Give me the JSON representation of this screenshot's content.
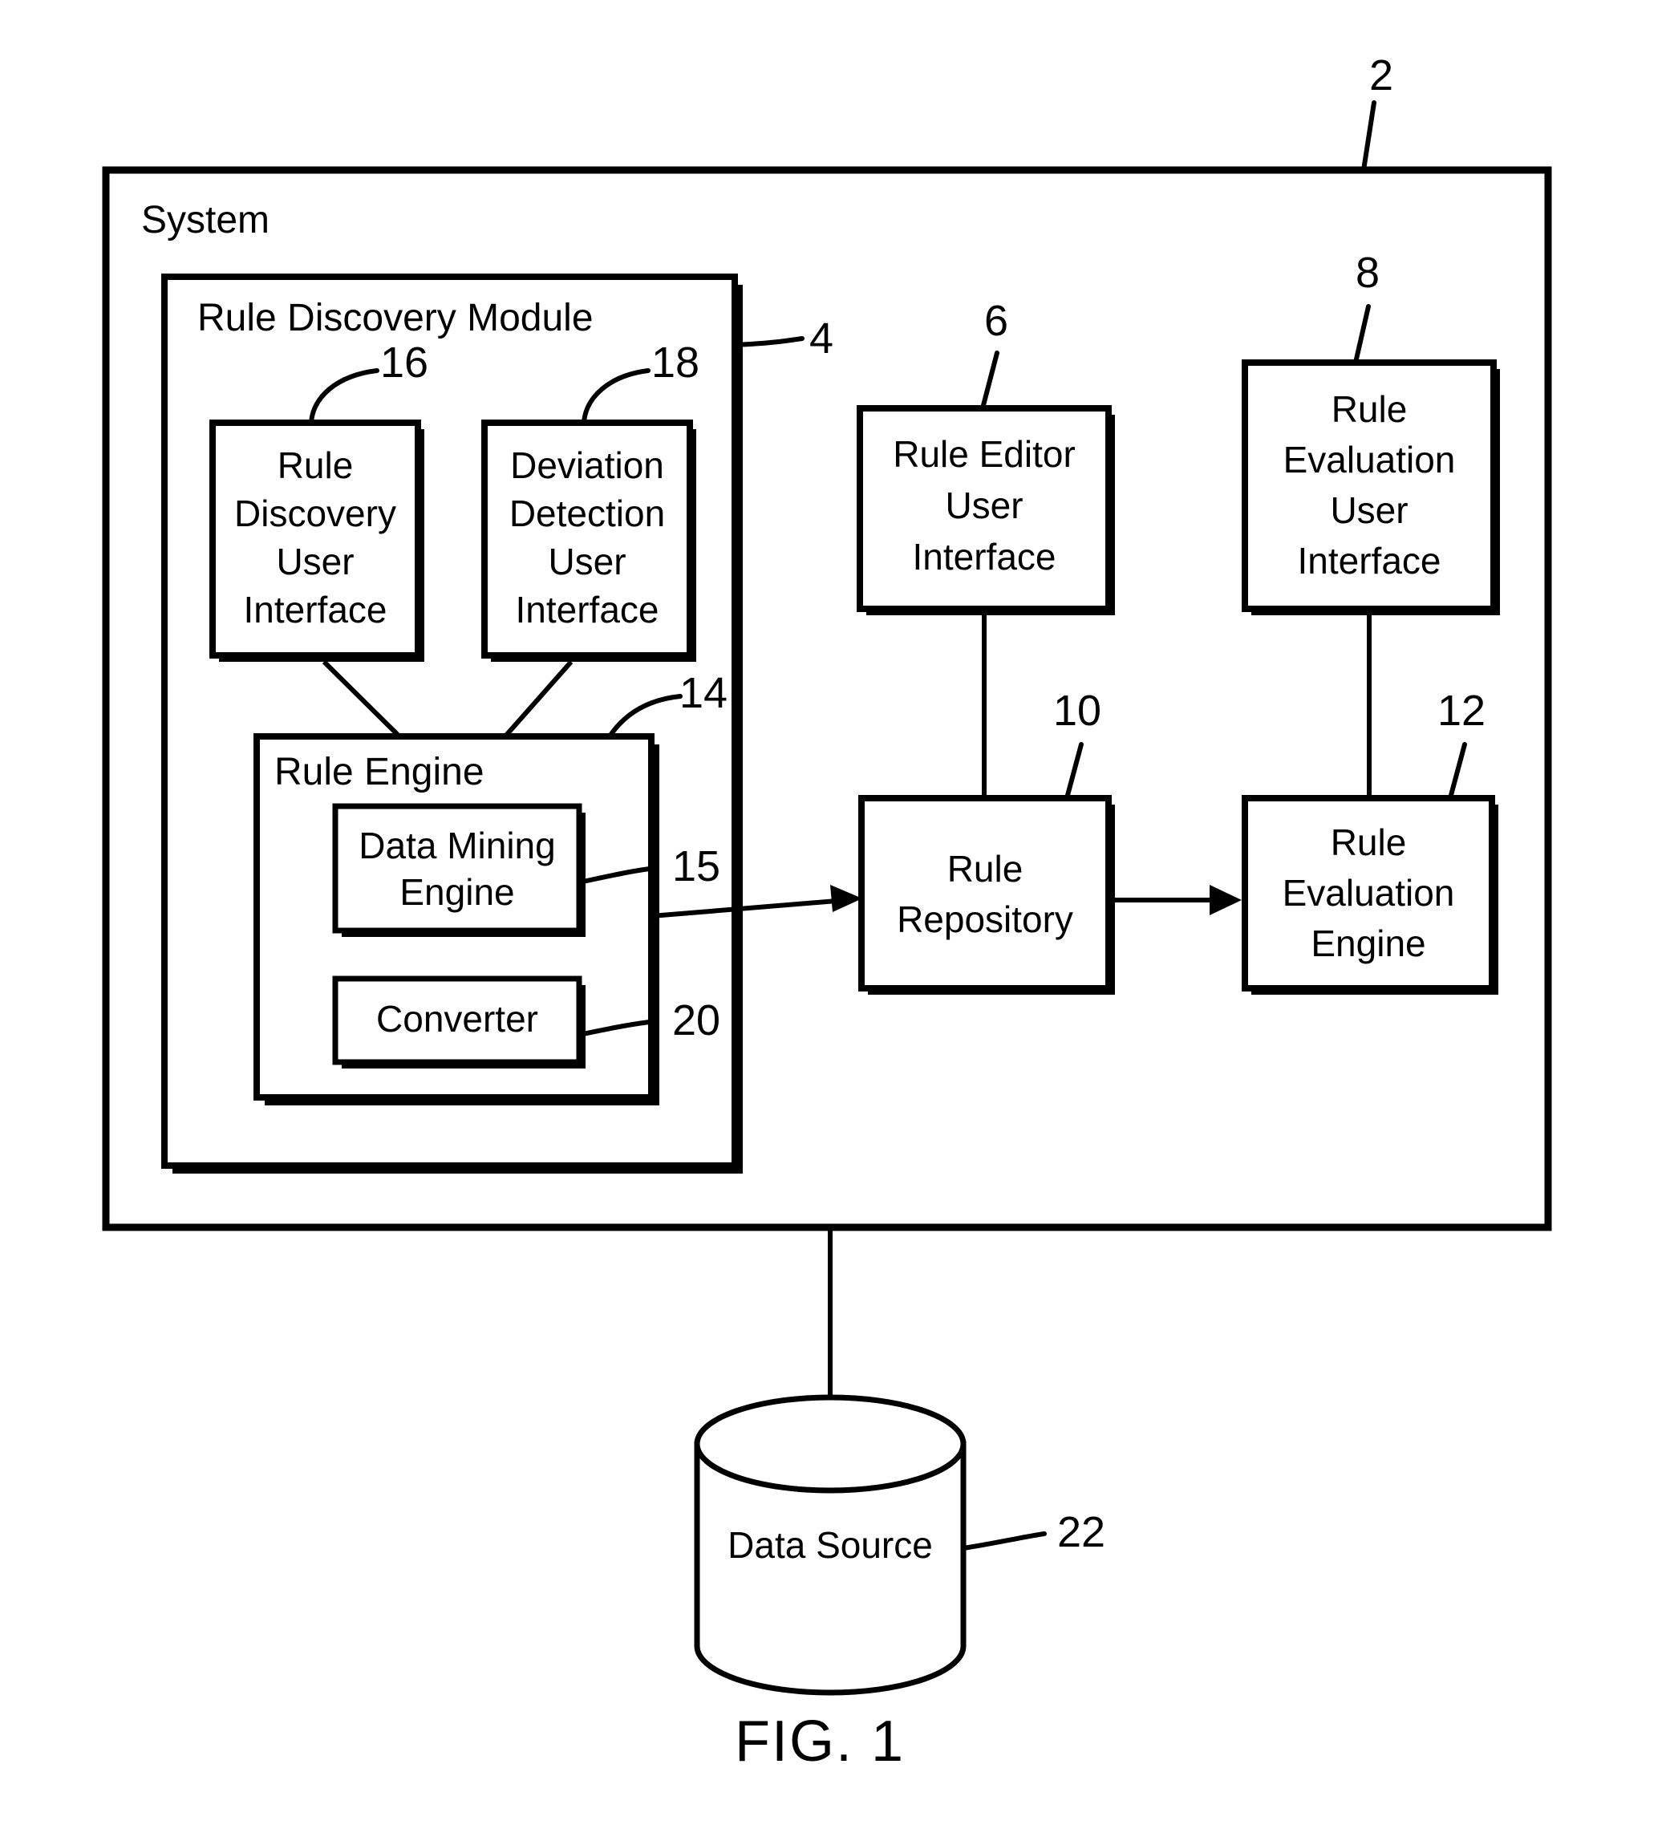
{
  "figure": {
    "caption": "FIG. 1",
    "type": "block-diagram"
  },
  "system": {
    "title": "System",
    "ref": "2"
  },
  "rule_discovery_module": {
    "title": "Rule Discovery Module",
    "ref": "4",
    "children": [
      {
        "label": "Rule\nDiscovery\nUser\nInterface",
        "line1": "Rule",
        "line2": "Discovery",
        "line3": "User",
        "line4": "Interface",
        "ref": "16"
      },
      {
        "label": "Deviation\nDetection\nUser\nInterface",
        "line1": "Deviation",
        "line2": "Detection",
        "line3": "User",
        "line4": "Interface",
        "ref": "18"
      }
    ],
    "rule_engine": {
      "title": "Rule Engine",
      "ref": "14",
      "children": [
        {
          "line1": "Data Mining",
          "line2": "Engine",
          "ref": "15"
        },
        {
          "line1": "Converter",
          "line2": "",
          "ref": "20"
        }
      ]
    }
  },
  "rule_editor_ui": {
    "line1": "Rule Editor",
    "line2": "User",
    "line3": "Interface",
    "ref": "6"
  },
  "rule_evaluation_ui": {
    "line1": "Rule",
    "line2": "Evaluation",
    "line3": "User",
    "line4": "Interface",
    "ref": "8"
  },
  "rule_repository": {
    "line1": "Rule",
    "line2": "Repository",
    "ref": "10"
  },
  "rule_evaluation_engine": {
    "line1": "Rule",
    "line2": "Evaluation",
    "line3": "Engine",
    "ref": "12"
  },
  "data_source": {
    "label": "Data Source",
    "ref": "22"
  },
  "colors": {
    "stroke": "#000000",
    "background": "#ffffff"
  }
}
